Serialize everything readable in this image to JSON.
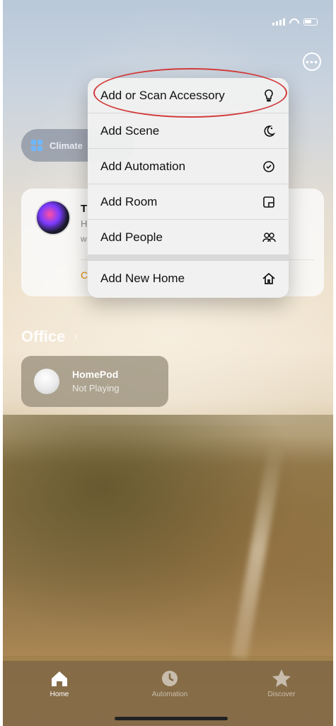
{
  "status_bar": {
    "icons": [
      "signal-icon",
      "wifi-icon",
      "battery-icon"
    ]
  },
  "header": {
    "more_icon": "ellipsis-circle-icon"
  },
  "climate_chip": {
    "label": "Climate"
  },
  "accessory_card": {
    "title": "T",
    "sub1": "H",
    "sub2": "w",
    "link": "C"
  },
  "context_menu": {
    "items": [
      {
        "label": "Add or Scan Accessory",
        "icon": "lightbulb-icon"
      },
      {
        "label": "Add Scene",
        "icon": "scene-moon-icon"
      },
      {
        "label": "Add Automation",
        "icon": "clock-check-icon"
      },
      {
        "label": "Add Room",
        "icon": "room-door-icon"
      },
      {
        "label": "Add People",
        "icon": "people-icon"
      },
      {
        "label": "Add New Home",
        "icon": "house-icon"
      }
    ],
    "highlighted_item": "Add or Scan Accessory",
    "highlight_color": "#d23a3a"
  },
  "office": {
    "title": "Office",
    "device": {
      "name": "HomePod",
      "status": "Not Playing"
    }
  },
  "tabbar": {
    "tabs": [
      {
        "label": "Home",
        "icon": "house-icon",
        "active": true
      },
      {
        "label": "Automation",
        "icon": "clock-icon",
        "active": false
      },
      {
        "label": "Discover",
        "icon": "star-icon",
        "active": false
      }
    ]
  }
}
